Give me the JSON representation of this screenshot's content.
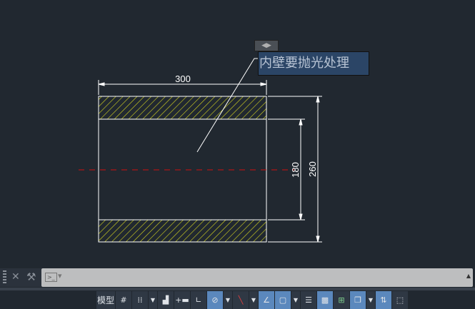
{
  "drawing": {
    "dim_width": "300",
    "dim_outer_height": "260",
    "dim_inner_height": "180",
    "annotation": "内壁要抛光处理",
    "colors": {
      "background": "#212830",
      "hatch": "#d8d820",
      "centerline": "#d01010",
      "lines": "#ffffff"
    }
  },
  "annotation_arrows": "◀▶",
  "command_line": {
    "close": "✕",
    "settings": "🔧",
    "prompt_icon": ">_",
    "dropdown": "▾",
    "expand": "▲"
  },
  "status_bar": {
    "model_label": "模型",
    "buttons": [
      "grid",
      "snap",
      "snap-dropdown",
      "infer",
      "dynamic-input",
      "ortho",
      "polar",
      "polar-dropdown",
      "isodraft",
      "isodraft-dropdown",
      "object-snap-tracking",
      "object-snap",
      "object-snap-dropdown",
      "lineweight",
      "transparency",
      "selection-cycling",
      "3d-osnap",
      "3d-osnap-dropdown",
      "dynamic-ucs",
      "selection-filter"
    ]
  }
}
